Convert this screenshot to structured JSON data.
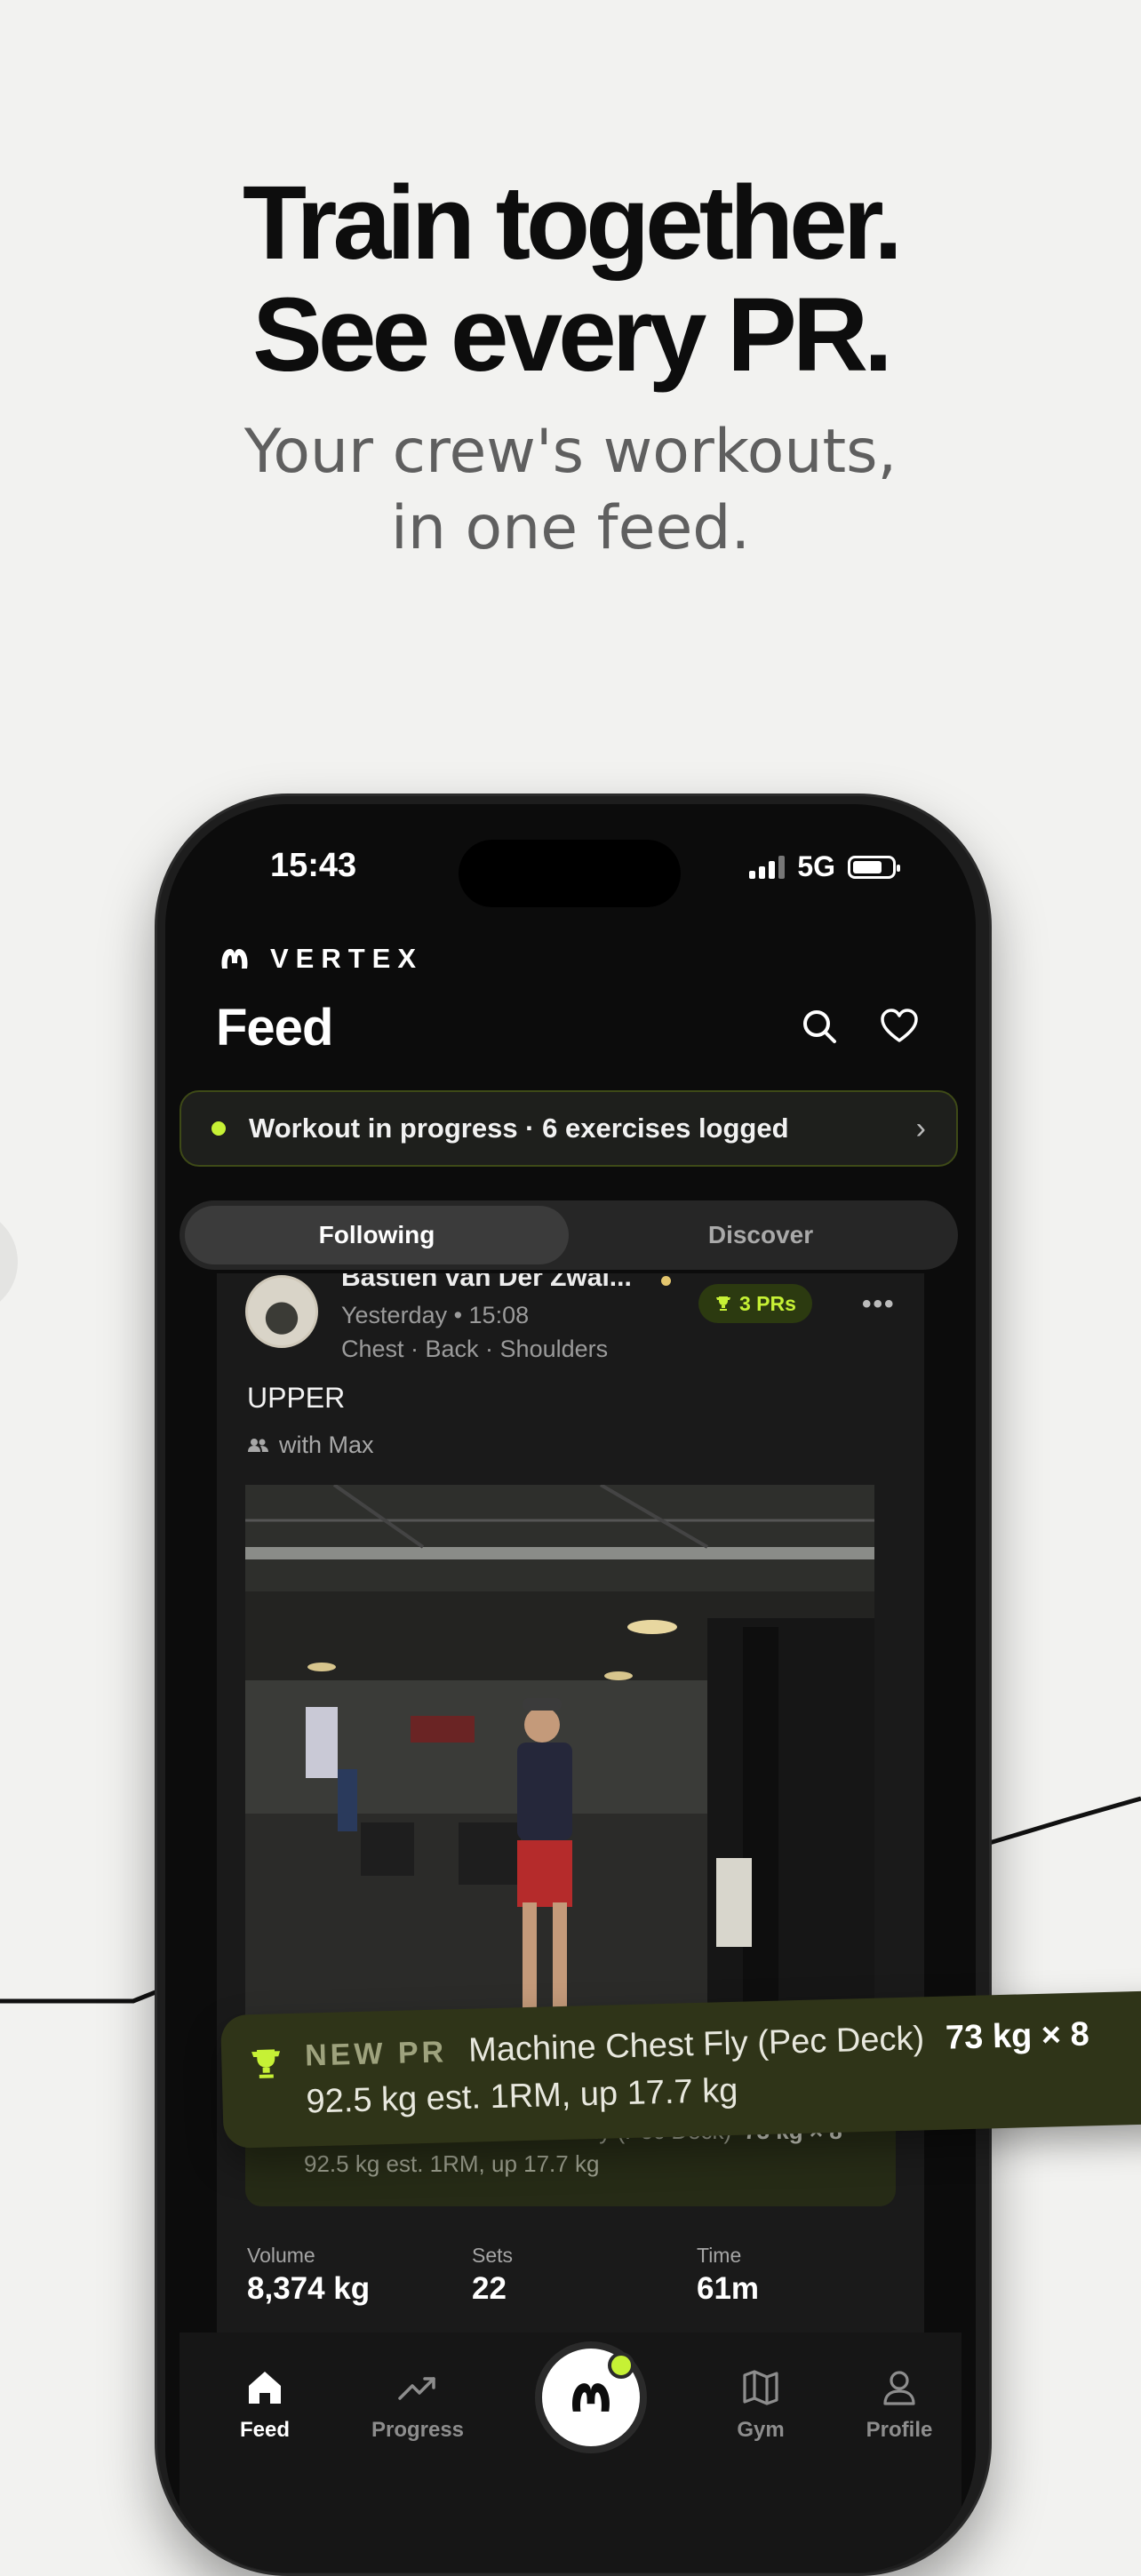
{
  "headline": {
    "line1": "Train together.",
    "line2": "See every PR."
  },
  "subhead": {
    "line1": "Your crew's workouts,",
    "line2": "in one feed."
  },
  "status_bar": {
    "time": "15:43",
    "network": "5G"
  },
  "app": {
    "brand": "VERTEX",
    "title": "Feed"
  },
  "workout_banner": {
    "text": "Workout in progress · 6 exercises logged"
  },
  "tabs": [
    "Following",
    "Discover"
  ],
  "post": {
    "user": "Bastien van Der Zwal...",
    "time": "Yesterday • 15:08",
    "muscles": "Chest · Back · Shoulders",
    "pr_badge": "3 PRs",
    "title": "UPPER",
    "with": "with Max",
    "pr": {
      "tag": "NEW PR",
      "exercise": "Machine Chest Fly (Pec Deck)",
      "value": "73 kg × 8",
      "detail": "92.5 kg est. 1RM, up 17.7 kg"
    },
    "stats": [
      {
        "label": "Volume",
        "value": "8,374 kg"
      },
      {
        "label": "Sets",
        "value": "22"
      },
      {
        "label": "Time",
        "value": "61m"
      }
    ]
  },
  "nav": {
    "feed": "Feed",
    "progress": "Progress",
    "gym": "Gym",
    "profile": "Profile"
  },
  "colors": {
    "accent": "#c6f135",
    "background": "#f2f2f0",
    "screen": "#0c0c0c"
  }
}
